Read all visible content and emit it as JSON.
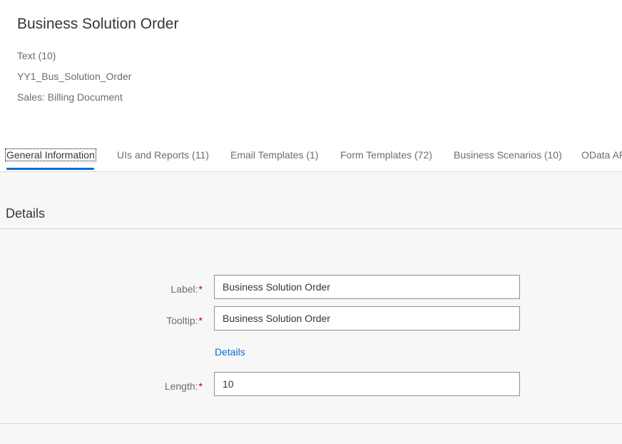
{
  "header": {
    "title": "Business Solution Order",
    "type": "Text (10)",
    "identifier": "YY1_Bus_Solution_Order",
    "business_context": "Sales: Billing Document"
  },
  "tabs": [
    {
      "label": "General Information",
      "active": true
    },
    {
      "label": "UIs and Reports (11)",
      "active": false
    },
    {
      "label": "Email Templates (1)",
      "active": false
    },
    {
      "label": "Form Templates (72)",
      "active": false
    },
    {
      "label": "Business Scenarios (10)",
      "active": false
    },
    {
      "label": "OData API",
      "active": false
    }
  ],
  "details": {
    "section_title": "Details",
    "label_field": {
      "label": "Label:",
      "required_mark": "*",
      "value": "Business Solution Order"
    },
    "tooltip_field": {
      "label": "Tooltip:",
      "required_mark": "*",
      "value": "Business Solution Order"
    },
    "details_link": "Details",
    "length_field": {
      "label": "Length:",
      "required_mark": "*",
      "value": "10"
    }
  },
  "colors": {
    "accent": "#0a6ed1",
    "required": "#bb0000",
    "background": "#f7f7f7"
  }
}
